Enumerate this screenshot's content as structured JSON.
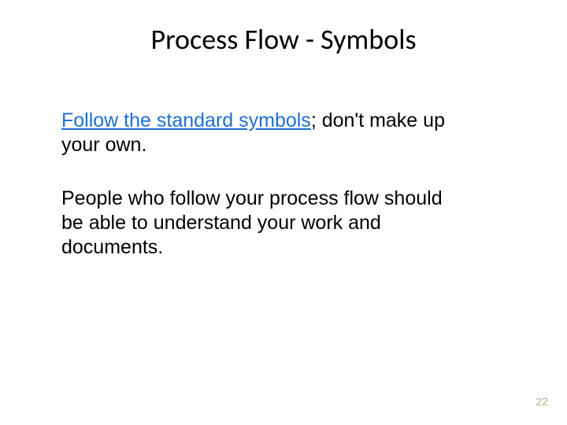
{
  "slide": {
    "title": "Process Flow - Symbols",
    "body": {
      "p1_link": "Follow the standard symbols",
      "p1_rest": "; don't make up your own.",
      "p2": "People who follow your process flow should be able to understand your work and documents."
    },
    "page_number": "22"
  }
}
